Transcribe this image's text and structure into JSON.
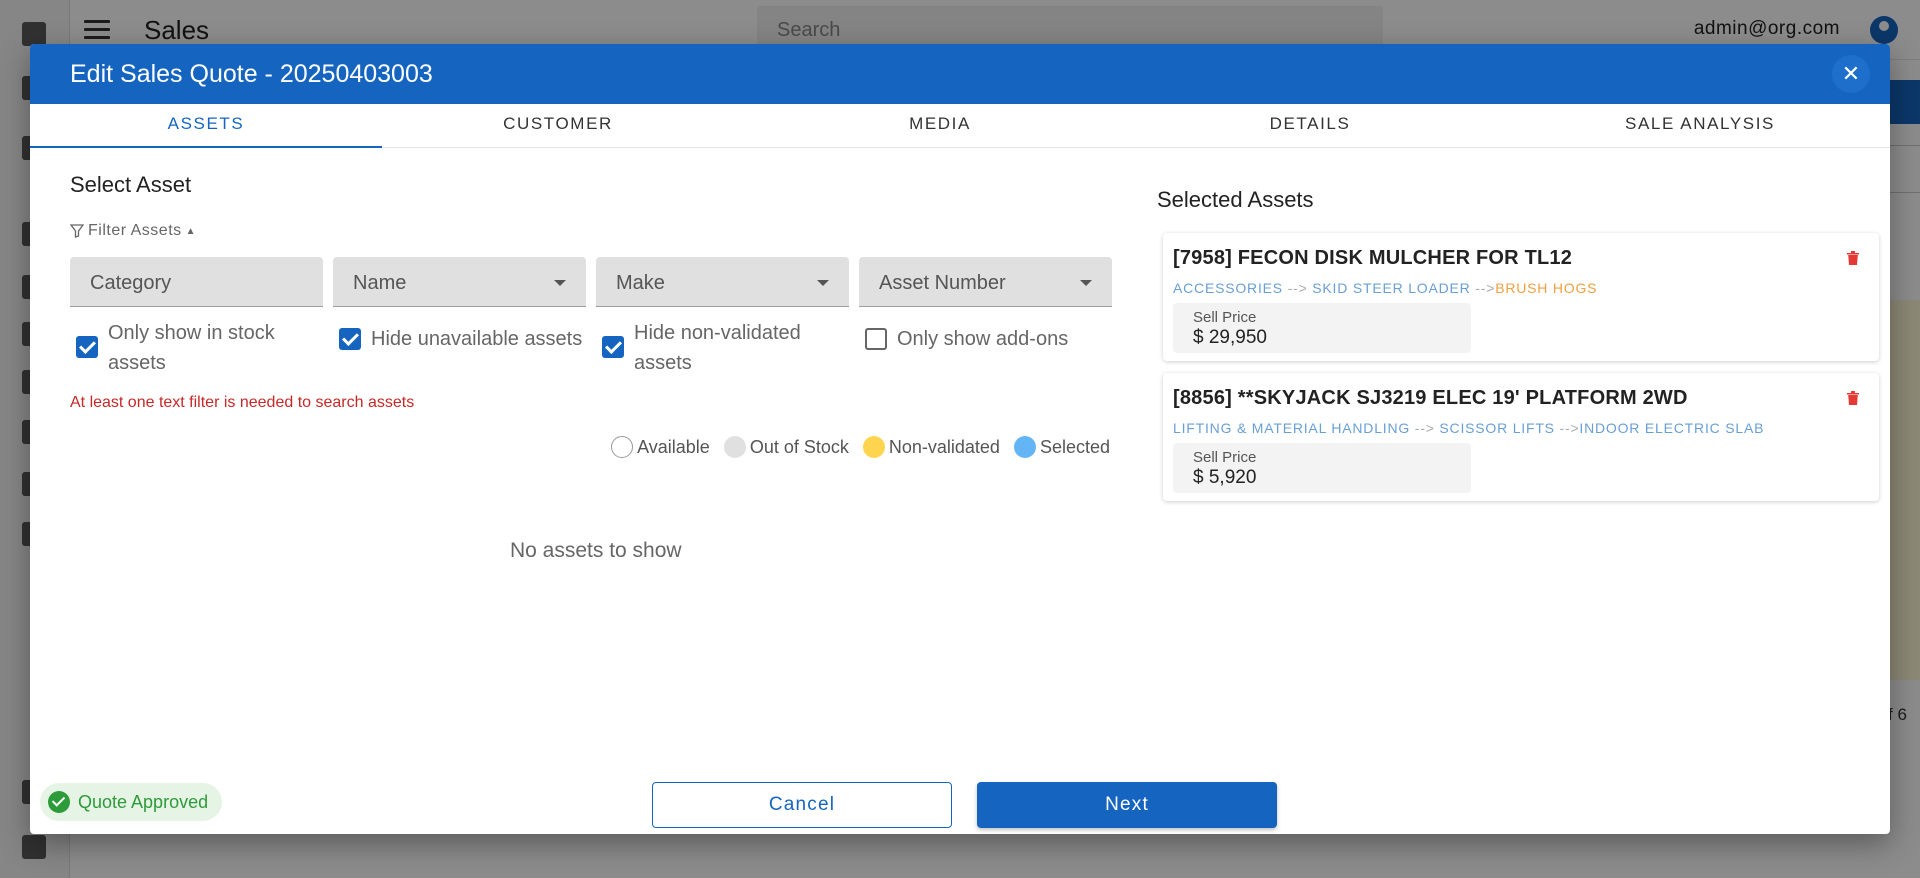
{
  "app": {
    "title": "Sales",
    "search_placeholder": "Search",
    "user_email": "admin@org.com",
    "pagination_fragment": "f 6"
  },
  "dialog": {
    "title": "Edit Sales Quote - 20250403003",
    "close_icon": "close-icon"
  },
  "tabs": [
    {
      "label": "ASSETS",
      "active": true
    },
    {
      "label": "CUSTOMER",
      "active": false
    },
    {
      "label": "MEDIA",
      "active": false
    },
    {
      "label": "DETAILS",
      "active": false
    },
    {
      "label": "SALE ANALYSIS",
      "active": false
    }
  ],
  "select_asset": {
    "title": "Select Asset",
    "filter_toggle": "Filter Assets",
    "fields": {
      "category": "Category",
      "name": "Name",
      "make": "Make",
      "asset_number": "Asset Number"
    },
    "checkboxes": [
      {
        "label": "Only show in stock assets",
        "checked": true
      },
      {
        "label": "Hide unavailable assets",
        "checked": true
      },
      {
        "label": "Hide non-validated assets",
        "checked": true
      },
      {
        "label": "Only show add-ons",
        "checked": false
      }
    ],
    "error": "At least one text filter is needed to search assets",
    "legend": [
      {
        "label": "Available",
        "color": "#ffffff"
      },
      {
        "label": "Out of Stock",
        "color": "#e0e0e0"
      },
      {
        "label": "Non-validated",
        "color": "#ffd54f"
      },
      {
        "label": "Selected",
        "color": "#64b5f6"
      }
    ],
    "empty_text": "No assets to show"
  },
  "selected_assets": {
    "title": "Selected Assets",
    "items": [
      {
        "title": "[7958] FECON DISK MULCHER FOR TL12",
        "crumbs": [
          "ACCESSORIES",
          "SKID STEER LOADER",
          "BRUSH HOGS"
        ],
        "price_label": "Sell Price",
        "price": "$ 29,950"
      },
      {
        "title": "[8856] **SKYJACK SJ3219 ELEC 19' PLATFORM 2WD",
        "crumbs": [
          "LIFTING & MATERIAL HANDLING",
          "SCISSOR LIFTS",
          "INDOOR ELECTRIC SLAB"
        ],
        "price_label": "Sell Price",
        "price": "$ 5,920"
      }
    ],
    "crumb_separator": "-->"
  },
  "footer": {
    "status": "Quote Approved",
    "cancel": "Cancel",
    "next": "Next"
  },
  "colors": {
    "primary": "#1565c0",
    "error": "#c62828",
    "success": "#2e9b3a",
    "crumb": "#6a9fd4",
    "crumb_leaf": "#f0a040"
  }
}
